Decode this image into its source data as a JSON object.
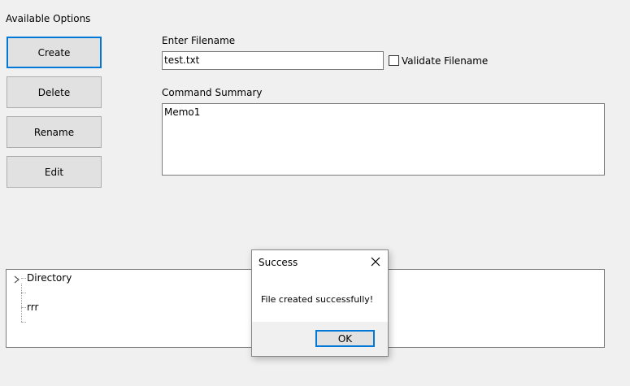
{
  "window": {
    "options_title": "Available Options",
    "filename_label": "Enter Filename",
    "filename_value": "test.txt",
    "validate_label": "Validate Filename",
    "validate_checked": false,
    "summary_label": "Command Summary",
    "summary_text": "Memo1"
  },
  "buttons": {
    "create": "Create",
    "delete": "Delete",
    "rename": "Rename",
    "edit": "Edit"
  },
  "tree": {
    "root": "Directory",
    "items": [
      "",
      "rrr",
      ""
    ]
  },
  "dialog": {
    "title": "Success",
    "message": "File created successfully!",
    "ok_label": "OK"
  },
  "colors": {
    "accent": "#0078d7",
    "background": "#f0f0f0"
  }
}
